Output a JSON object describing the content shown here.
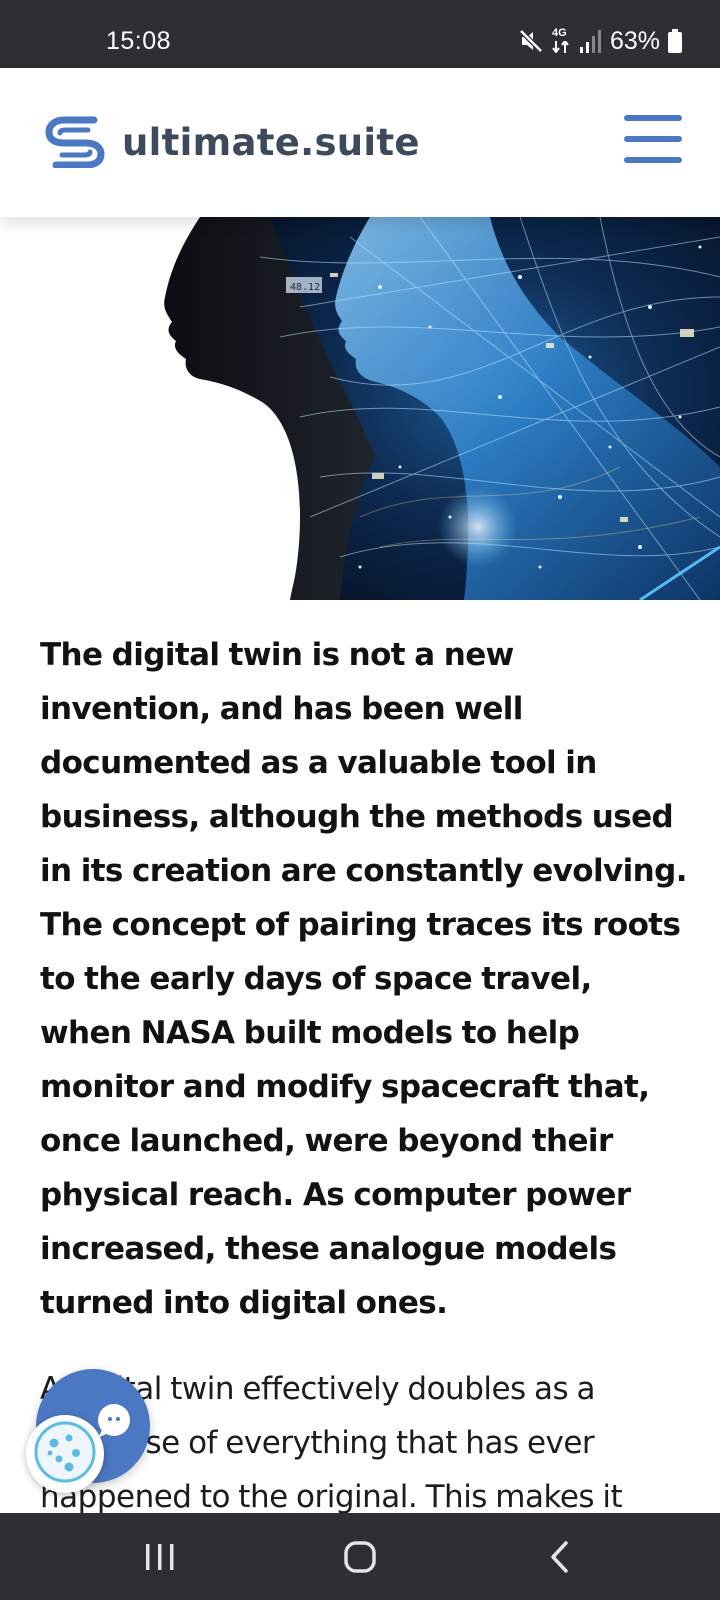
{
  "status_bar": {
    "time": "15:08",
    "network_label": "4G",
    "battery_percent": "63%",
    "icons": [
      "mute-icon",
      "network-4g-icon",
      "signal-icon",
      "battery-icon"
    ]
  },
  "header": {
    "brand_name": "ultimate.suite",
    "logo_icon": "ultimate-suite-logo-icon",
    "menu_icon": "hamburger-menu-icon",
    "brand_color": "#4b78c2"
  },
  "hero": {
    "hud_label": "48.12"
  },
  "article": {
    "paragraph_1": "The digital twin is not a new invention, and has been well documented as a valuable tool in business, although the methods used in its creation are constantly evolving. The concept of pairing traces its roots to the early days of space travel, when NASA built models to help monitor and modify spacecraft that, once launched, were beyond their physical reach. As computer power increased, these analogue models turned into digital ones.",
    "paragraph_2": "A digital twin effectively doubles as a database of everything that has ever happened to the original. This makes it"
  },
  "widgets": {
    "chat_icon": "chat-bubble-icon",
    "cookie_icon": "cookie-icon"
  },
  "nav_bar": {
    "icons": [
      "recent-apps-icon",
      "home-icon",
      "back-icon"
    ]
  }
}
